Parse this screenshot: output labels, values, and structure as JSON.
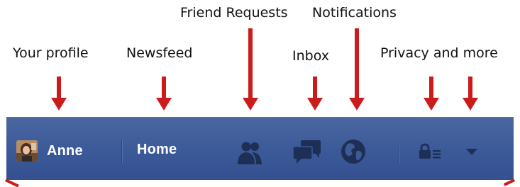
{
  "callouts": {
    "profile": "Your profile",
    "newsfeed": "Newsfeed",
    "friend_requests": "Friend Requests",
    "notifications": "Notifications",
    "inbox": "Inbox",
    "privacy": "Privacy and more"
  },
  "navbar": {
    "user_name": "Anne",
    "home_label": "Home",
    "icons": {
      "friend_requests": "friends-icon",
      "inbox": "messages-icon",
      "notifications": "globe-icon",
      "privacy": "lock-icon",
      "menu": "chevron-down-icon"
    }
  },
  "colors": {
    "bar": "#3b5998",
    "icon": "#1d2f55",
    "arrow": "#cc1b1b",
    "text": "#111111"
  }
}
